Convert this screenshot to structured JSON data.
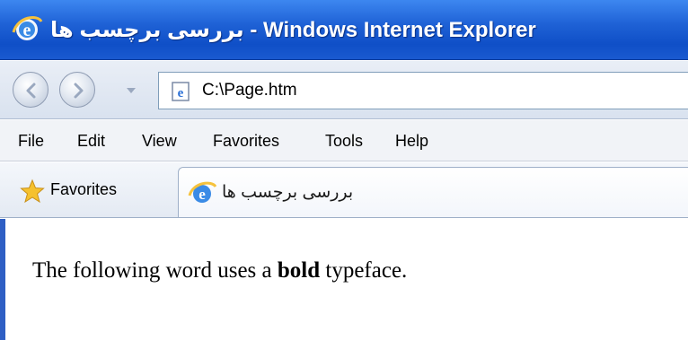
{
  "window": {
    "title": "بررسی برچسب ها - Windows Internet Explorer"
  },
  "address_bar": {
    "url": "C:\\Page.htm"
  },
  "menu": {
    "items": [
      "File",
      "Edit",
      "View",
      "Favorites",
      "Tools",
      "Help"
    ]
  },
  "favorites_bar": {
    "favorites_label": "Favorites"
  },
  "tab": {
    "title": "بررسی برچسب ها"
  },
  "content": {
    "text_before": "The following word uses a ",
    "bold_word": "bold",
    "text_after": " typeface."
  },
  "colors": {
    "titlebar_blue": "#1f62d6",
    "window_border": "#2e5fc4"
  },
  "icons": {
    "title": "ie-logo-icon",
    "back": "back-arrow-icon",
    "forward": "forward-arrow-icon",
    "page": "ie-page-icon",
    "favorites": "favorites-star-icon",
    "tab": "ie-logo-icon"
  }
}
